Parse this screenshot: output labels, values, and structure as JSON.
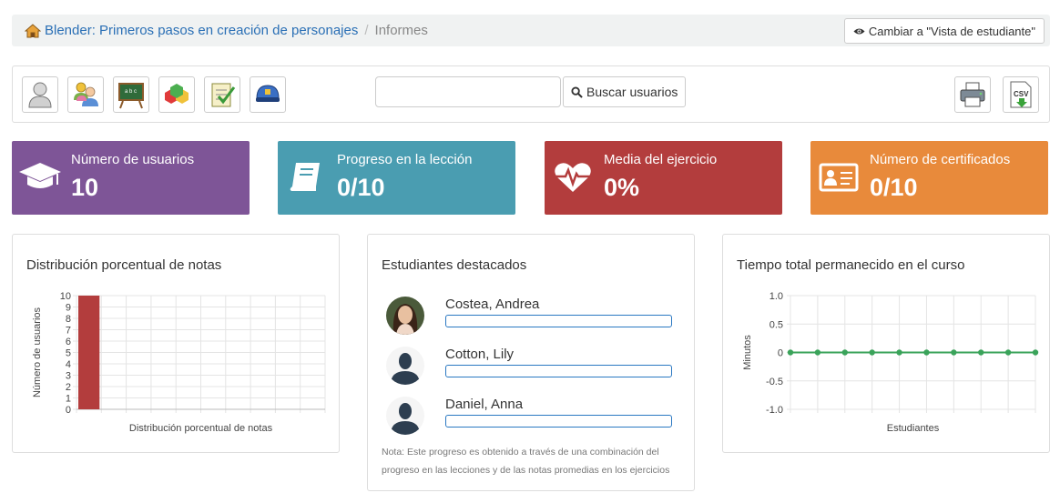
{
  "breadcrumb": {
    "course": "Blender: Primeros pasos en creación de personajes",
    "separator": "/",
    "current": "Informes"
  },
  "header": {
    "student_view_button": "Cambiar a \"Vista de estudiante\""
  },
  "toolbar": {
    "tools": [
      {
        "icon": "user-icon"
      },
      {
        "icon": "users-group-icon"
      },
      {
        "icon": "blackboard-icon"
      },
      {
        "icon": "blocks-icon"
      },
      {
        "icon": "checklist-icon"
      },
      {
        "icon": "police-helmet-icon"
      }
    ],
    "search": {
      "value": "",
      "placeholder": ""
    },
    "search_button": "Buscar usuarios",
    "print_icon": "printer-icon",
    "csv_icon": "csv-download-icon",
    "csv_text": "CSV"
  },
  "stats": [
    {
      "label": "Número de usuarios",
      "value": "10",
      "icon": "graduation-cap-icon",
      "color": "#7e5597"
    },
    {
      "label": "Progreso en la lección",
      "value": "0/10",
      "icon": "book-icon",
      "color": "#4a9db1"
    },
    {
      "label": "Media del ejercicio",
      "value": "0%",
      "icon": "heartbeat-icon",
      "color": "#b33d3d"
    },
    {
      "label": "Número de certificados",
      "value": "0/10",
      "icon": "id-card-icon",
      "color": "#e88a3b"
    }
  ],
  "panels": {
    "grades": {
      "title": "Distribución porcentual de notas"
    },
    "top_students": {
      "title": "Estudiantes destacados",
      "students": [
        {
          "name": "Costea, Andrea",
          "avatar": "photo-avatar",
          "progress": 0
        },
        {
          "name": "Cotton, Lily",
          "avatar": "default-avatar-icon",
          "progress": 0
        },
        {
          "name": "Daniel, Anna",
          "avatar": "default-avatar-icon",
          "progress": 0
        }
      ],
      "note": "Nota: Este progreso es obtenido a través de una combinación del progreso en las lecciones y de las notas promedias en los ejercicios"
    },
    "time": {
      "title": "Tiempo total permanecido en el curso"
    }
  },
  "chart_data": [
    {
      "type": "bar",
      "title": "",
      "xlabel": "Distribución porcentual de notas",
      "ylabel": "Número de usuarios",
      "categories": [
        "",
        "",
        "",
        "",
        "",
        "",
        "",
        "",
        "",
        ""
      ],
      "values": [
        10,
        0,
        0,
        0,
        0,
        0,
        0,
        0,
        0,
        0
      ],
      "yticks": [
        "0",
        "1",
        "2",
        "3",
        "4",
        "5",
        "6",
        "7",
        "8",
        "9",
        "10"
      ],
      "ylim": [
        0,
        10
      ],
      "bar_color": "#b33d3d",
      "grid": true
    },
    {
      "type": "line",
      "title": "",
      "xlabel": "Estudiantes",
      "ylabel": "Minutos",
      "x": [
        "",
        "",
        "",
        "",
        "",
        "",
        "",
        "",
        "",
        ""
      ],
      "values": [
        0,
        0,
        0,
        0,
        0,
        0,
        0,
        0,
        0,
        0
      ],
      "yticks": [
        "1.0",
        "0.5",
        "0",
        "-0.5",
        "-1.0"
      ],
      "ylim": [
        -1,
        1
      ],
      "line_color": "#3aa35a",
      "grid": true
    }
  ]
}
